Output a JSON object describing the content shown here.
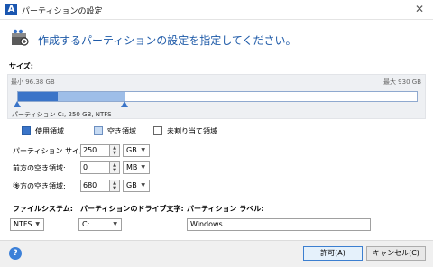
{
  "window": {
    "title": "パーティションの設定",
    "logo": "A"
  },
  "header": {
    "text": "作成するパーティションの設定を指定してください。"
  },
  "size": {
    "label": "サイズ:",
    "min_label": "最小 96.38 GB",
    "max_label": "最大 930 GB",
    "partition_info": "パーティション C:, 250 GB, NTFS",
    "used_fraction": 0.1,
    "partition_fraction": 0.27
  },
  "legend": {
    "used": "使用領域",
    "free": "空き領域",
    "unallocated": "未割り当て領域"
  },
  "fields": {
    "partition_size": {
      "label": "パーティション サイズ:",
      "value": "250",
      "unit": "GB"
    },
    "free_before": {
      "label": "前方の空き領域:",
      "value": "0",
      "unit": "MB"
    },
    "free_after": {
      "label": "後方の空き領域:",
      "value": "680",
      "unit": "GB"
    }
  },
  "filesystem": {
    "label": "ファイルシステム:",
    "value": "NTFS"
  },
  "drive_letter": {
    "label": "パーティションのドライブ文字:",
    "value": "C:"
  },
  "volume_label": {
    "label": "パーティション ラベル:",
    "value": "Windows"
  },
  "buttons": {
    "ok": "許可(A)",
    "cancel": "キャンセル(C)",
    "help": "?"
  },
  "colors": {
    "accent": "#1e5aa8",
    "used": "#3a74c8",
    "partition": "#9ebee8"
  }
}
